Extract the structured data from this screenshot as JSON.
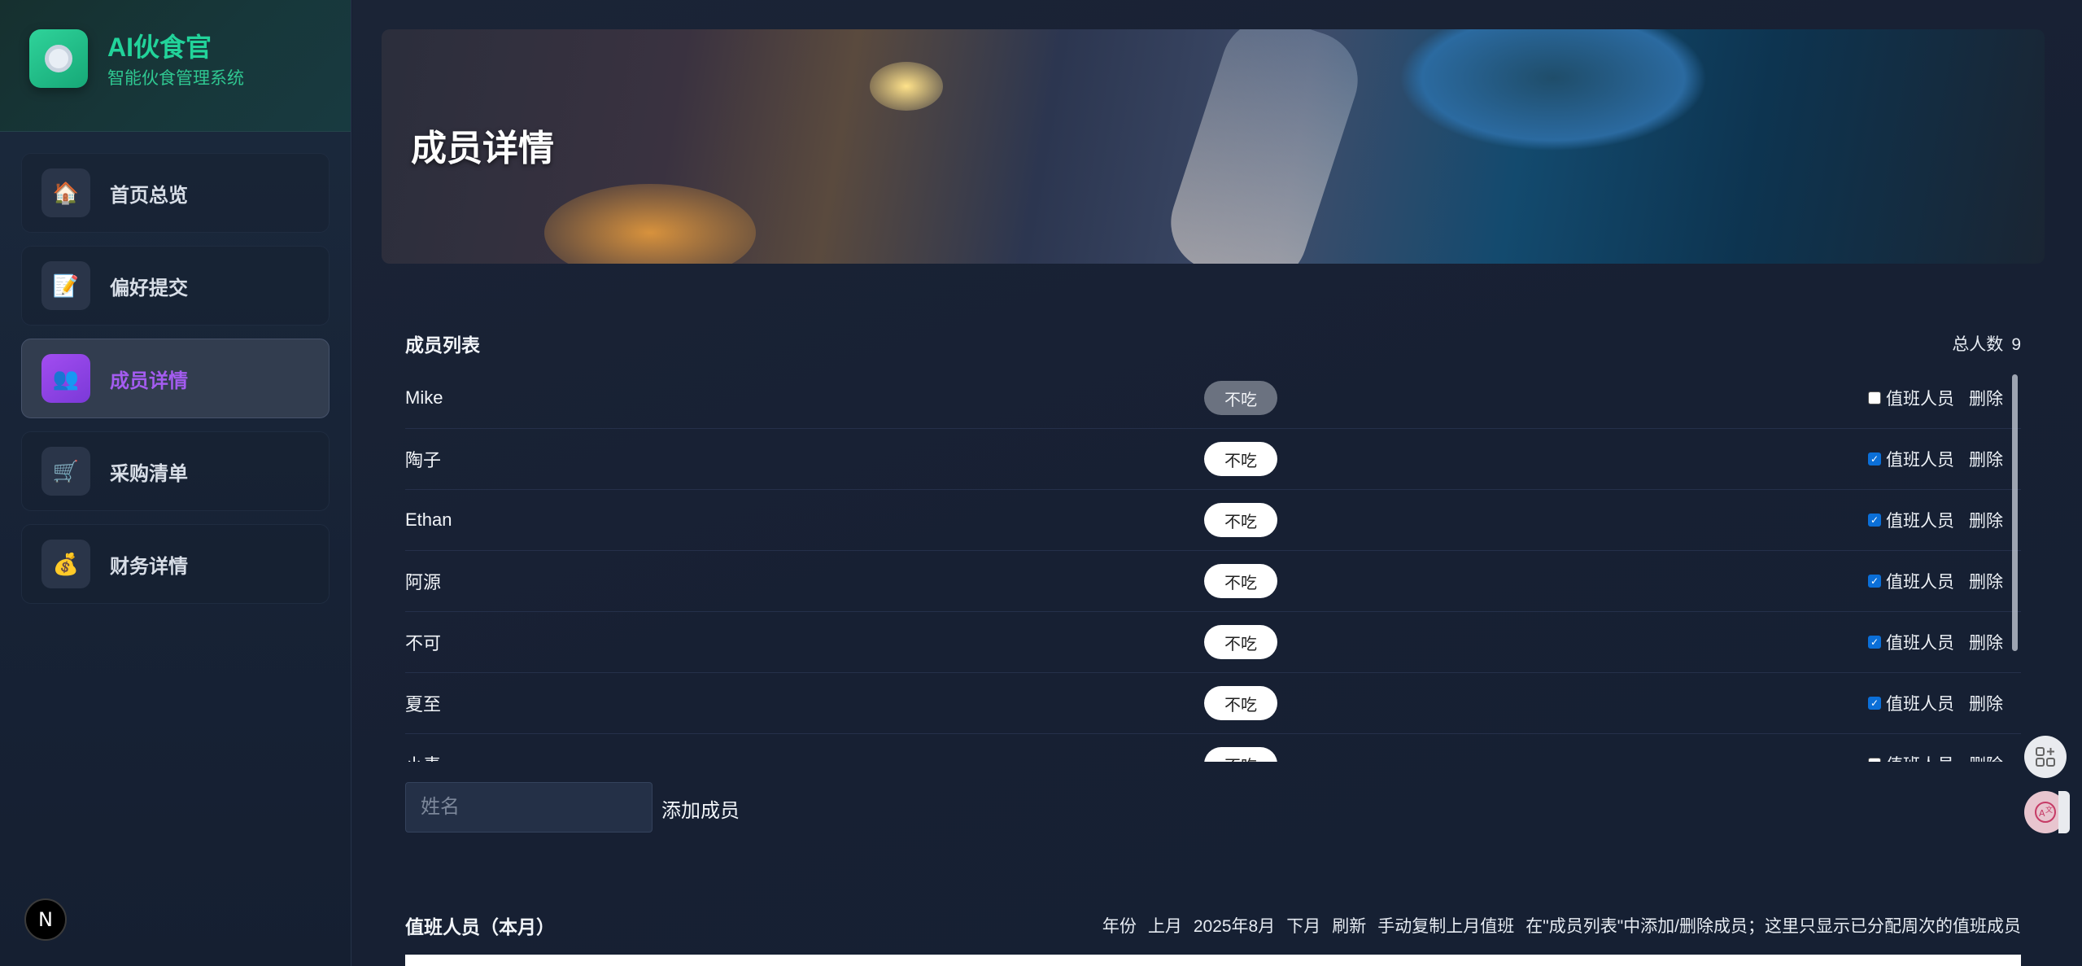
{
  "brand": {
    "title": "AI伙食官",
    "subtitle": "智能伙食管理系统",
    "logo_icon": "plate-icon"
  },
  "nav": {
    "items": [
      {
        "label": "首页总览",
        "icon": "house-icon",
        "glyph": "🏠",
        "active": false
      },
      {
        "label": "偏好提交",
        "icon": "memo-icon",
        "glyph": "📝",
        "active": false
      },
      {
        "label": "成员详情",
        "icon": "people-icon",
        "glyph": "👥",
        "active": true
      },
      {
        "label": "采购清单",
        "icon": "cart-icon",
        "glyph": "🛒",
        "active": false
      },
      {
        "label": "财务详情",
        "icon": "money-bag-icon",
        "glyph": "💰",
        "active": false
      }
    ]
  },
  "hero": {
    "title": "成员详情"
  },
  "members": {
    "title": "成员列表",
    "total_label": "总人数",
    "total_value": "9",
    "duty_label": "值班人员",
    "delete_label": "删除",
    "rows": [
      {
        "name": "Mike",
        "status": "不吃",
        "status_style": "off",
        "duty": false
      },
      {
        "name": "陶子",
        "status": "不吃",
        "status_style": "on",
        "duty": true
      },
      {
        "name": "Ethan",
        "status": "不吃",
        "status_style": "on",
        "duty": true
      },
      {
        "name": "阿源",
        "status": "不吃",
        "status_style": "on",
        "duty": true
      },
      {
        "name": "不可",
        "status": "不吃",
        "status_style": "on",
        "duty": true
      },
      {
        "name": "夏至",
        "status": "不吃",
        "status_style": "on",
        "duty": true
      },
      {
        "name": "小毒",
        "status": "不吃",
        "status_style": "on",
        "duty": false
      }
    ],
    "name_placeholder": "姓名",
    "add_label": "添加成员"
  },
  "duty": {
    "title": "值班人员（本月）",
    "year_label": "年份",
    "prev_label": "上月",
    "current_month": "2025年8月",
    "next_label": "下月",
    "refresh_label": "刷新",
    "copy_label": "手动复制上月值班",
    "hint": "在\"成员列表\"中添加/删除成员；这里只显示已分配周次的值班成员"
  },
  "floating": {
    "apps_icon": "apps-add-icon",
    "translate_icon": "translate-icon"
  },
  "badge": {
    "letter": "N"
  }
}
